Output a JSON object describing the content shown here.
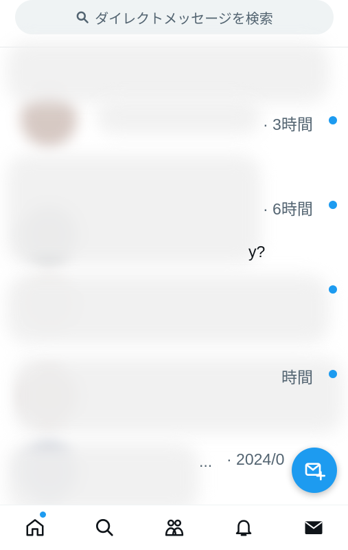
{
  "search": {
    "placeholder": "ダイレクトメッセージを検索",
    "icon": "search-icon"
  },
  "conversations": [
    {
      "time": "· 3時間",
      "unread": true
    },
    {
      "time": "· 6時間",
      "unread": true,
      "preview_fragment": "y?"
    },
    {
      "time": "",
      "unread": true
    },
    {
      "time": "時間",
      "unread": true
    },
    {
      "time": "· 2024/0",
      "unread": false,
      "preview_fragment": "..."
    }
  ],
  "colors": {
    "accent": "#1d9bf0",
    "text_secondary": "#536471",
    "search_bg": "#eff3f4"
  },
  "bottom_nav": [
    {
      "name": "home-icon",
      "has_badge": true
    },
    {
      "name": "search-icon"
    },
    {
      "name": "communities-icon"
    },
    {
      "name": "notifications-bell-icon"
    },
    {
      "name": "messages-envelope-icon",
      "active": true
    }
  ],
  "fab": {
    "icon": "new-message-icon"
  }
}
